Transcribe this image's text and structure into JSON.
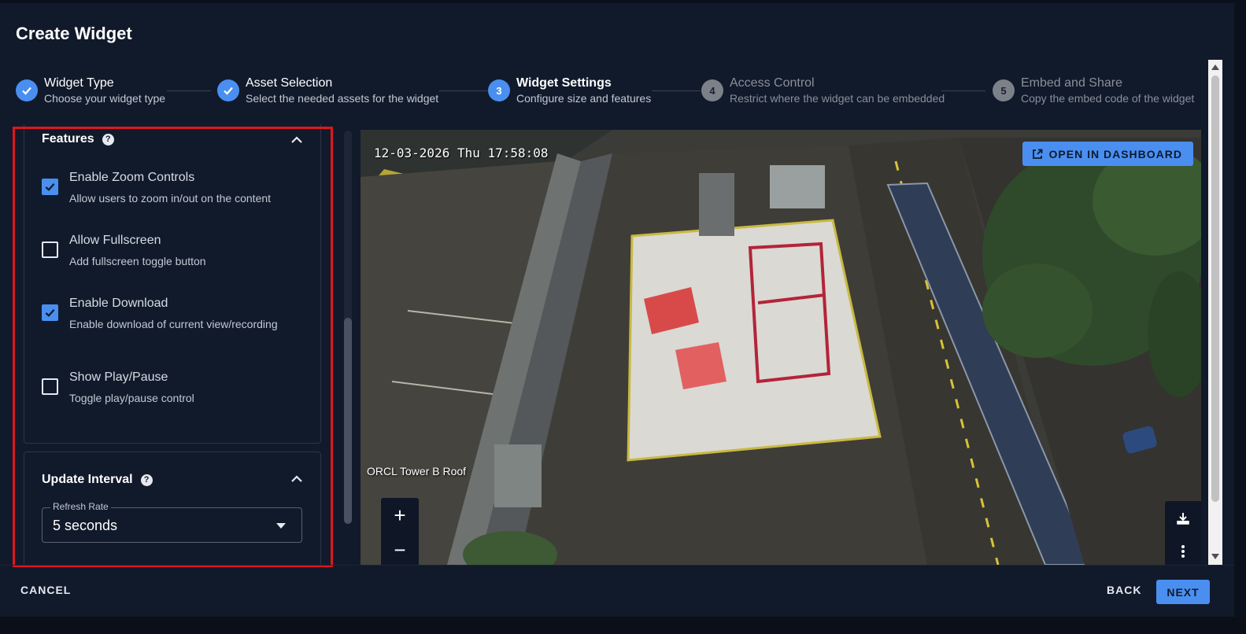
{
  "dialog": {
    "title": "Create Widget"
  },
  "stepper": {
    "steps": [
      {
        "label": "Widget Type",
        "sub": "Choose your widget type",
        "number": "1",
        "state": "done"
      },
      {
        "label": "Asset Selection",
        "sub": "Select the needed assets for the widget",
        "number": "2",
        "state": "done"
      },
      {
        "label": "Widget Settings",
        "sub": "Configure size and features",
        "number": "3",
        "state": "active"
      },
      {
        "label": "Access Control",
        "sub": "Restrict where the widget can be embedded",
        "number": "4",
        "state": "todo"
      },
      {
        "label": "Embed and Share",
        "sub": "Copy the embed code of the widget",
        "number": "5",
        "state": "todo"
      }
    ]
  },
  "features": {
    "title": "Features",
    "options": [
      {
        "label": "Enable Zoom Controls",
        "sub": "Allow users to zoom in/out on the content",
        "checked": true
      },
      {
        "label": "Allow Fullscreen",
        "sub": "Add fullscreen toggle button",
        "checked": false
      },
      {
        "label": "Enable Download",
        "sub": "Enable download of current view/recording",
        "checked": true
      },
      {
        "label": "Show Play/Pause",
        "sub": "Toggle play/pause control",
        "checked": false
      }
    ]
  },
  "interval": {
    "title": "Update Interval",
    "refresh_label": "Refresh Rate",
    "refresh_value": "5 seconds"
  },
  "viewer": {
    "timestamp": "12-03-2026 Thu 17:58:08",
    "camera_name": "ORCL Tower B Roof",
    "open_dashboard": "OPEN IN DASHBOARD",
    "zoom_in": "+",
    "zoom_out": "−"
  },
  "footer": {
    "cancel": "CANCEL",
    "back": "BACK",
    "next": "NEXT"
  },
  "colors": {
    "accent": "#4a8ff0",
    "highlight": "#e0161e",
    "background": "#111a2b"
  }
}
